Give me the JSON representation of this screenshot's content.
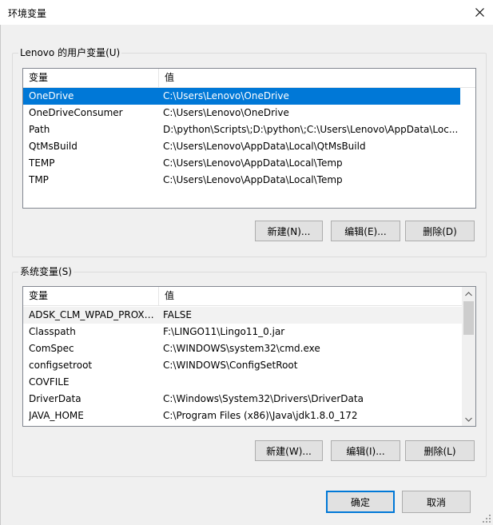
{
  "window": {
    "title": "环境变量"
  },
  "user_vars": {
    "group_label": "Lenovo 的用户变量(U)",
    "col_name": "变量",
    "col_value": "值",
    "rows": [
      {
        "name": "OneDrive",
        "value": "C:\\Users\\Lenovo\\OneDrive",
        "selected": true
      },
      {
        "name": "OneDriveConsumer",
        "value": "C:\\Users\\Lenovo\\OneDrive"
      },
      {
        "name": "Path",
        "value": "D:\\python\\Scripts\\;D:\\python\\;C:\\Users\\Lenovo\\AppData\\Loc..."
      },
      {
        "name": "QtMsBuild",
        "value": "C:\\Users\\Lenovo\\AppData\\Local\\QtMsBuild"
      },
      {
        "name": "TEMP",
        "value": "C:\\Users\\Lenovo\\AppData\\Local\\Temp"
      },
      {
        "name": "TMP",
        "value": "C:\\Users\\Lenovo\\AppData\\Local\\Temp"
      }
    ],
    "btn_new": "新建(N)...",
    "btn_edit": "编辑(E)...",
    "btn_delete": "删除(D)"
  },
  "system_vars": {
    "group_label": "系统变量(S)",
    "col_name": "变量",
    "col_value": "值",
    "rows": [
      {
        "name": "ADSK_CLM_WPAD_PROXY_...",
        "value": "FALSE",
        "highlight": true
      },
      {
        "name": "Classpath",
        "value": "F:\\LINGO11\\Lingo11_0.jar"
      },
      {
        "name": "ComSpec",
        "value": "C:\\WINDOWS\\system32\\cmd.exe"
      },
      {
        "name": "configsetroot",
        "value": "C:\\WINDOWS\\ConfigSetRoot"
      },
      {
        "name": "COVFILE",
        "value": ""
      },
      {
        "name": "DriverData",
        "value": "C:\\Windows\\System32\\Drivers\\DriverData"
      },
      {
        "name": "JAVA_HOME",
        "value": "C:\\Program Files (x86)\\Java\\jdk1.8.0_172"
      }
    ],
    "btn_new": "新建(W)...",
    "btn_edit": "编辑(I)...",
    "btn_delete": "删除(L)"
  },
  "footer": {
    "ok": "确定",
    "cancel": "取消"
  },
  "icons": {
    "close": "close-icon",
    "scroll_up": "chevron-up-icon",
    "scroll_down": "chevron-down-icon",
    "resize": "resize-grip-icon"
  },
  "colors": {
    "selection": "#0078d7",
    "default_button_border": "#0078d7"
  }
}
